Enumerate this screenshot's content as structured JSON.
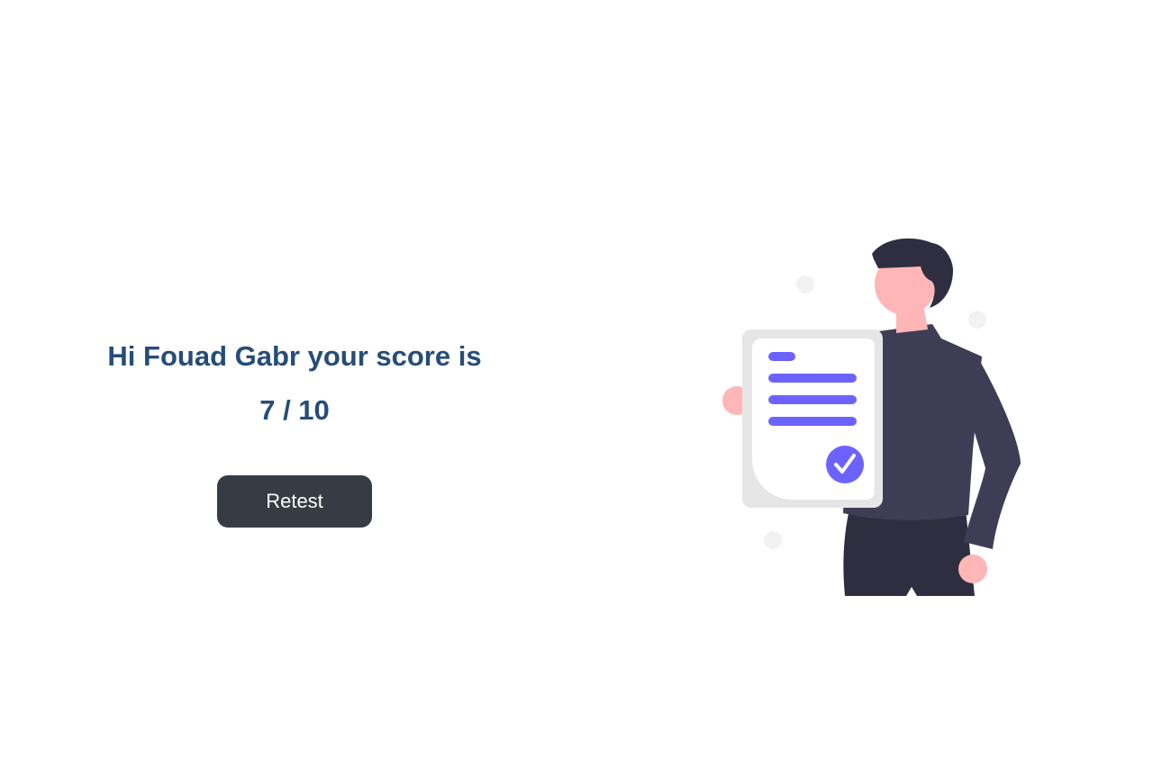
{
  "result": {
    "greeting": "Hi Fouad Gabr your score is",
    "score_text": "7 / 10",
    "score": 7,
    "total": 10
  },
  "actions": {
    "retest_label": "Retest"
  },
  "illustration": {
    "icon": "person-holding-checked-document-illustration",
    "colors": {
      "accent": "#6c63ff",
      "skin": "#ffb6b6",
      "shirt": "#3f3d56",
      "hair": "#2f2e41",
      "pants": "#2f2e41",
      "paper_frame": "#e6e6e6",
      "paper": "#ffffff",
      "dots": "#f2f2f2"
    }
  }
}
